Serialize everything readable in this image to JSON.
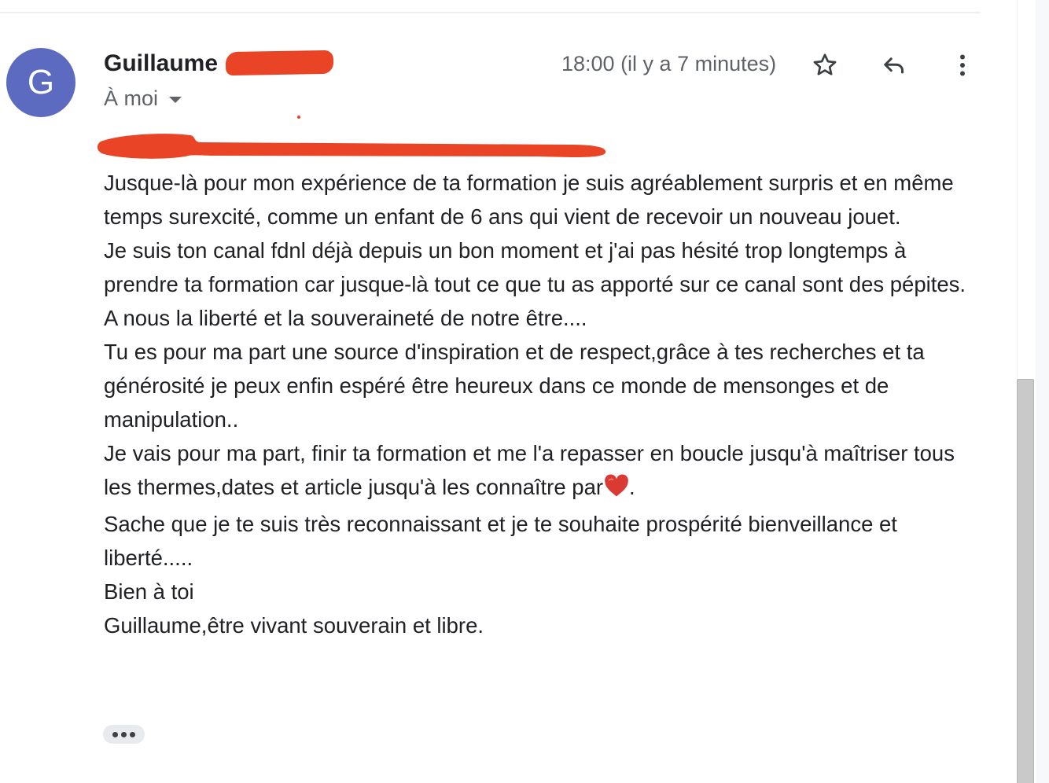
{
  "message": {
    "avatar_letter": "G",
    "sender_name": "Guillaume",
    "recipient_label": "À moi",
    "timestamp": "18:00 (il y a 7 minutes)",
    "body_lines": [
      "Jusque-là pour mon expérience de ta formation je suis agréablement surpris et en même temps surexcité, comme un enfant de 6 ans qui vient de recevoir un nouveau jouet.",
      "Je suis ton canal fdnl déjà depuis un bon moment et j'ai pas hésité trop longtemps à prendre ta formation car jusque-là tout ce que tu as apporté sur ce canal sont des pépites.",
      "A nous la liberté et la souveraineté de notre être....",
      "Tu es pour ma part une source d'inspiration et de respect,grâce à tes recherches et ta générosité je peux enfin espéré être heureux dans ce monde de mensonges et de manipulation..",
      "Je vais pour ma part, finir ta formation et me l'a repasser en boucle jusqu'à maîtriser tous les thermes,dates et article jusqu'à les connaître par",
      "Sache que je te suis très reconnaissant et je te souhaite prospérité bienveillance et liberté.....",
      "Bien à toi",
      "Guillaume,être vivant souverain et libre."
    ],
    "heart_suffix": "."
  },
  "icons": {
    "star": "star-outline-icon",
    "reply": "reply-icon",
    "more": "more-vertical-icon",
    "heart": "red-heart-emoji",
    "trimmed": "show-trimmed-content-icon"
  },
  "colors": {
    "avatar_bg": "#5c6bc0",
    "redaction": "#ea4426",
    "text_primary": "#202124",
    "text_secondary": "#5f6368"
  }
}
